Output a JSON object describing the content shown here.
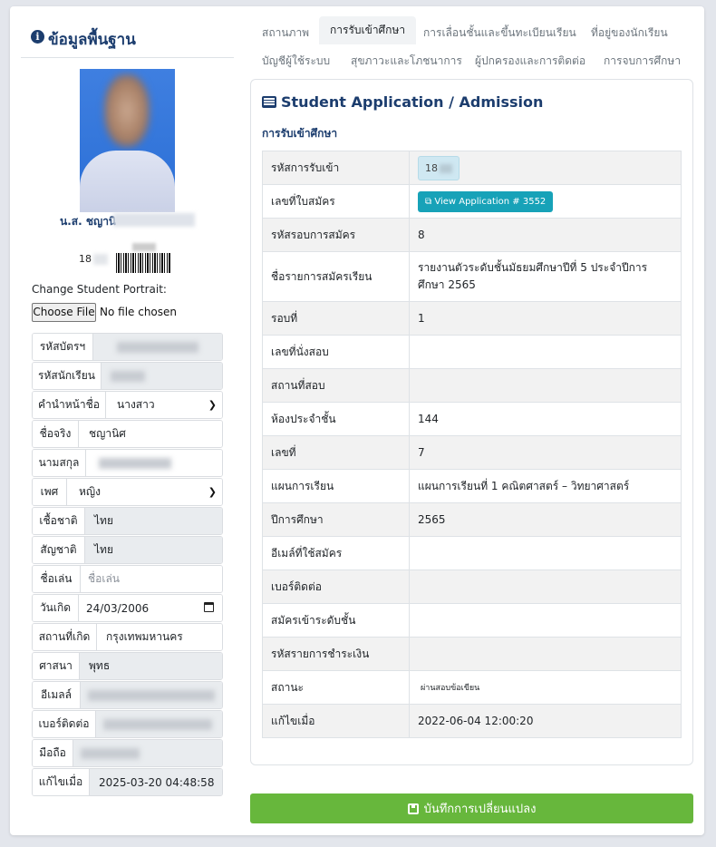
{
  "left": {
    "title": "ข้อมูลพื้นฐาน",
    "student_name": "น.ส. ชญานิ",
    "student_code": "18",
    "change_portrait_label": "Change Student Portrait:",
    "choose_file_label": "Choose File",
    "no_file_label": "No file chosen",
    "fields": [
      {
        "label": "รหัสบัตรฯ",
        "value": ""
      },
      {
        "label": "รหัสนักเรียน",
        "value": ""
      },
      {
        "label": "คำนำหน้าชื่อ",
        "value": "นางสาว"
      },
      {
        "label": "ชื่อจริง",
        "value": "ชญานิศ"
      },
      {
        "label": "นามสกุล",
        "value": ""
      },
      {
        "label": "เพศ",
        "value": "หญิง"
      },
      {
        "label": "เชื้อชาติ",
        "value": "ไทย"
      },
      {
        "label": "สัญชาติ",
        "value": "ไทย"
      },
      {
        "label": "ชื่อเล่น",
        "value": "",
        "placeholder": "ชื่อเล่น"
      },
      {
        "label": "วันเกิด",
        "value": "24/03/2006"
      },
      {
        "label": "สถานที่เกิด",
        "value": "กรุงเทพมหานคร"
      },
      {
        "label": "ศาสนา",
        "value": "พุทธ"
      },
      {
        "label": "อีเมลล์",
        "value": ""
      },
      {
        "label": "เบอร์ติดต่อ",
        "value": ""
      },
      {
        "label": "มือถือ",
        "value": ""
      },
      {
        "label": "แก้ไขเมื่อ",
        "value": "2025-03-20 04:48:58"
      }
    ]
  },
  "tabs": [
    {
      "label": "สถานภาพ"
    },
    {
      "label": "การรับเข้าศึกษา"
    },
    {
      "label": "การเลื่อนชั้นและขึ้นทะเบียนเรียน"
    },
    {
      "label": "ที่อยู่ของนักเรียน"
    },
    {
      "label": "บัญชีผู้ใช้ระบบ"
    },
    {
      "label": "สุขภาวะและโภชนาการ"
    },
    {
      "label": "ผู้ปกครองและการติดต่อ"
    },
    {
      "label": "การจบการศึกษา"
    }
  ],
  "panel": {
    "title": "Student Application / Admission",
    "subheading": "การรับเข้าศึกษา",
    "rows": [
      {
        "key": "รหัสการรับเข้า",
        "value": "18"
      },
      {
        "key": "เลขที่ใบสมัคร",
        "value": "View Application # 3552"
      },
      {
        "key": "รหัสรอบการสมัคร",
        "value": "8"
      },
      {
        "key": "ชื่อรายการสมัครเรียน",
        "value": "รายงานตัวระดับชั้นมัธยมศึกษาปีที่ 5 ประจำปีการศึกษา 2565"
      },
      {
        "key": "รอบที่",
        "value": "1"
      },
      {
        "key": "เลขที่นั่งสอบ",
        "value": ""
      },
      {
        "key": "สถานที่สอบ",
        "value": ""
      },
      {
        "key": "ห้องประจำชั้น",
        "value": "144"
      },
      {
        "key": "เลขที่",
        "value": "7"
      },
      {
        "key": "แผนการเรียน",
        "value": "แผนการเรียนที่ 1 คณิตศาสตร์ – วิทยาศาสตร์"
      },
      {
        "key": "ปีการศึกษา",
        "value": "2565"
      },
      {
        "key": "อีเมล์ที่ใช้สมัคร",
        "value": ""
      },
      {
        "key": "เบอร์ติดต่อ",
        "value": ""
      },
      {
        "key": "สมัครเข้าระดับชั้น",
        "value": ""
      },
      {
        "key": "รหัสรายการชำระเงิน",
        "value": ""
      },
      {
        "key": "สถานะ",
        "value": "ผ่านสอบข้อเขียน"
      },
      {
        "key": "แก้ไขเมื่อ",
        "value": "2022-06-04 12:00:20"
      }
    ]
  },
  "save_label": "บันทึกการเปลี่ยนแปลง",
  "colors": {
    "accent": "#1c3d6e",
    "save": "#67b73c",
    "info_btn": "#17a2b8"
  }
}
